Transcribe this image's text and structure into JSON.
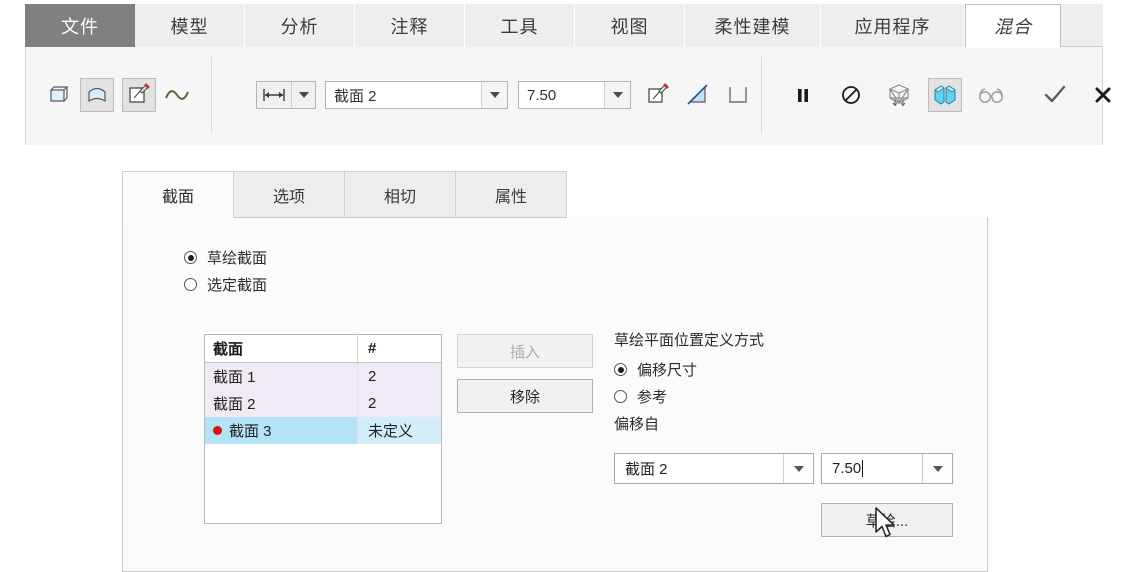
{
  "ribbon": {
    "tabs": [
      {
        "label": "文件",
        "state": "file"
      },
      {
        "label": "模型",
        "state": "normal"
      },
      {
        "label": "分析",
        "state": "normal"
      },
      {
        "label": "注释",
        "state": "normal"
      },
      {
        "label": "工具",
        "state": "normal"
      },
      {
        "label": "视图",
        "state": "normal"
      },
      {
        "label": "柔性建模",
        "state": "normal"
      },
      {
        "label": "应用程序",
        "state": "normal"
      },
      {
        "label": "混合",
        "state": "active"
      }
    ]
  },
  "toolbar": {
    "shape_buttons": [
      {
        "name": "surface-flat-icon",
        "state": "normal"
      },
      {
        "name": "surface-curved-icon",
        "state": "toggled"
      },
      {
        "name": "sketch-edit-icon",
        "state": "toggled"
      },
      {
        "name": "curve-icon",
        "state": "normal"
      }
    ],
    "depth_combo": {
      "icon": "measure-width-icon",
      "arrow": "chevron-down-icon"
    },
    "section_combo": {
      "value": "截面 2",
      "arrow": "chevron-down-icon"
    },
    "offset_combo": {
      "value": "7.50",
      "arrow": "chevron-down-icon"
    },
    "right_icons": [
      {
        "name": "sketch-pencil-icon",
        "state": "normal"
      },
      {
        "name": "taper-angle-icon",
        "state": "normal"
      },
      {
        "name": "thicken-icon",
        "state": "normal"
      }
    ],
    "preview_icons": [
      {
        "name": "pause-icon",
        "state": "normal"
      },
      {
        "name": "no-preview-icon",
        "state": "normal"
      },
      {
        "name": "wireframe-preview-icon",
        "state": "normal"
      },
      {
        "name": "shaded-preview-icon",
        "state": "toggled"
      },
      {
        "name": "glasses-preview-icon",
        "state": "normal"
      }
    ],
    "confirm_icons": [
      {
        "name": "accept-check-icon",
        "state": "normal"
      },
      {
        "name": "cancel-x-icon",
        "state": "normal"
      }
    ]
  },
  "panel": {
    "tabs": [
      {
        "label": "截面",
        "active": true
      },
      {
        "label": "选项",
        "active": false
      },
      {
        "label": "相切",
        "active": false
      },
      {
        "label": "属性",
        "active": false
      }
    ],
    "section_mode": {
      "options": [
        {
          "label": "草绘截面",
          "selected": true
        },
        {
          "label": "选定截面",
          "selected": false
        }
      ]
    },
    "table": {
      "headers": [
        "截面",
        "#"
      ],
      "rows": [
        {
          "name": "截面 1",
          "count": "2",
          "marker": false,
          "selected": false,
          "alt": true
        },
        {
          "name": "截面 2",
          "count": "2",
          "marker": false,
          "selected": false,
          "alt": true
        },
        {
          "name": "截面 3",
          "count": "未定义",
          "marker": true,
          "selected": true,
          "alt": false
        }
      ]
    },
    "buttons": {
      "insert": {
        "label": "插入",
        "enabled": false
      },
      "remove": {
        "label": "移除",
        "enabled": true
      },
      "sketch": {
        "label": "草绘..."
      }
    },
    "plane_def": {
      "title": "草绘平面位置定义方式",
      "options": [
        {
          "label": "偏移尺寸",
          "selected": true
        },
        {
          "label": "参考",
          "selected": false
        }
      ],
      "offset_from_label": "偏移自",
      "offset_from_value": "截面 2",
      "offset_value": "7.50"
    }
  },
  "colors": {
    "file_tab_bg": "#808080",
    "ribbon_bg": "#eeeeee",
    "panel_bg": "#fbfbfb",
    "row_alt": "#efeaf4",
    "row_selected": "#b2e3f7",
    "marker_red": "#dd1111",
    "accent_blue": "#7fd4ee"
  }
}
